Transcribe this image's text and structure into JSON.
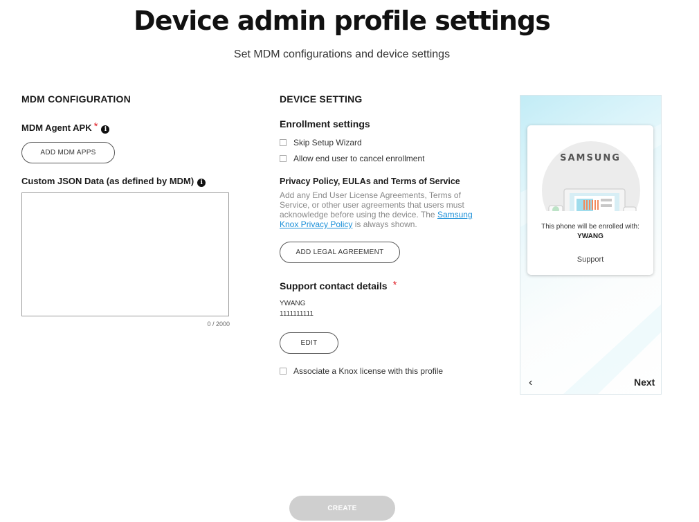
{
  "header": {
    "title": "Device admin profile settings",
    "subtitle": "Set MDM configurations and device settings"
  },
  "mdm": {
    "section_title": "MDM CONFIGURATION",
    "agent_apk_label": "MDM Agent APK",
    "required_mark": "*",
    "add_apps_button": "ADD MDM APPS",
    "json_label": "Custom JSON Data (as defined by MDM)",
    "json_value": "",
    "json_counter": "0 / 2000"
  },
  "device": {
    "section_title": "DEVICE SETTING",
    "enrollment_title": "Enrollment settings",
    "skip_wizard_label": "Skip Setup Wizard",
    "skip_wizard_checked": false,
    "allow_cancel_label": "Allow end user to cancel enrollment",
    "allow_cancel_checked": false,
    "legal_title": "Privacy Policy, EULAs and Terms of Service",
    "legal_desc_before": "Add any End User License Agreements, Terms of Service, or other user agreements that users must acknowledge before using the device. The",
    "legal_link": "Samsung Knox Privacy Policy",
    "legal_desc_after": "is always shown.",
    "add_legal_button": "ADD LEGAL AGREEMENT",
    "support_title": "Support contact details",
    "required_mark": "*",
    "support_name": "YWANG",
    "support_phone": "1111111111",
    "edit_button": "EDIT",
    "knox_license_label": "Associate a Knox license with this profile",
    "knox_license_checked": false
  },
  "preview": {
    "brand": "SAMSUNG",
    "enrolled_text": "This phone will be enrolled with:",
    "enrolled_name": "YWANG",
    "support_link": "Support",
    "back_symbol": "‹",
    "next_label": "Next"
  },
  "footer": {
    "create_button": "CREATE"
  },
  "colors": {
    "required": "#e0242b",
    "link": "#1a8fd8",
    "disabled_button": "#cfcfcf"
  }
}
